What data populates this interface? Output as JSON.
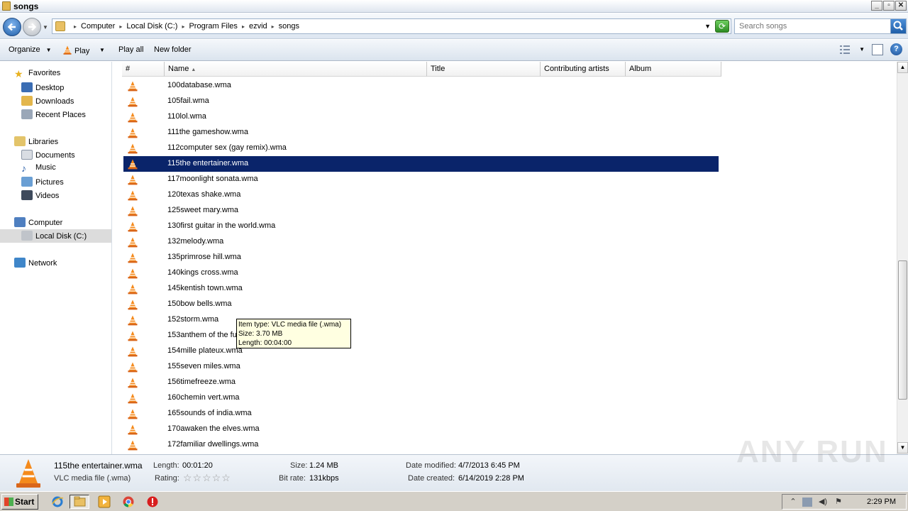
{
  "window": {
    "title": "songs"
  },
  "address": {
    "crumbs": [
      "Computer",
      "Local Disk (C:)",
      "Program Files",
      "ezvid",
      "songs"
    ]
  },
  "search": {
    "placeholder": "Search songs"
  },
  "toolbar": {
    "organize": "Organize",
    "play": "Play",
    "play_all": "Play all",
    "new_folder": "New folder"
  },
  "nav": {
    "favorites": "Favorites",
    "desktop": "Desktop",
    "downloads": "Downloads",
    "recent": "Recent Places",
    "libraries": "Libraries",
    "documents": "Documents",
    "music": "Music",
    "pictures": "Pictures",
    "videos": "Videos",
    "computer": "Computer",
    "local_disk": "Local Disk (C:)",
    "network": "Network"
  },
  "columns": {
    "num": "#",
    "name": "Name",
    "title": "Title",
    "artists": "Contributing artists",
    "album": "Album"
  },
  "files": [
    "100database.wma",
    "105fail.wma",
    "110lol.wma",
    "111the gameshow.wma",
    "112computer sex (gay remix).wma",
    "115the entertainer.wma",
    "117moonlight sonata.wma",
    "120texas shake.wma",
    "125sweet mary.wma",
    "130first guitar in the world.wma",
    "132melody.wma",
    "135primrose hill.wma",
    "140kings cross.wma",
    "145kentish town.wma",
    "150bow bells.wma",
    "152storm.wma",
    "153anthem of the fu",
    "154mille plateux.wma",
    "155seven miles.wma",
    "156timefreeze.wma",
    "160chemin vert.wma",
    "165sounds of india.wma",
    "170awaken the elves.wma",
    "172familiar dwellings.wma"
  ],
  "selected_file": "115the entertainer.wma",
  "tooltip": {
    "type": "Item type: VLC media file (.wma)",
    "size": "Size: 3.70 MB",
    "length": "Length: 00:04:00"
  },
  "details": {
    "filename": "115the entertainer.wma",
    "filetype": "VLC media file (.wma)",
    "length_label": "Length:",
    "length": "00:01:20",
    "rating_label": "Rating:",
    "size_label": "Size:",
    "size": "1.24 MB",
    "bitrate_label": "Bit rate:",
    "bitrate": "131kbps",
    "modified_label": "Date modified:",
    "modified": "4/7/2013 6:45 PM",
    "created_label": "Date created:",
    "created": "6/14/2019 2:28 PM",
    "rating_stars": "☆☆☆☆☆"
  },
  "watermark": "ANY RUN",
  "taskbar": {
    "start": "Start",
    "clock": "2:29 PM"
  },
  "colors": {
    "selection": "#0a246a",
    "tooltip_bg": "#ffffe1"
  }
}
